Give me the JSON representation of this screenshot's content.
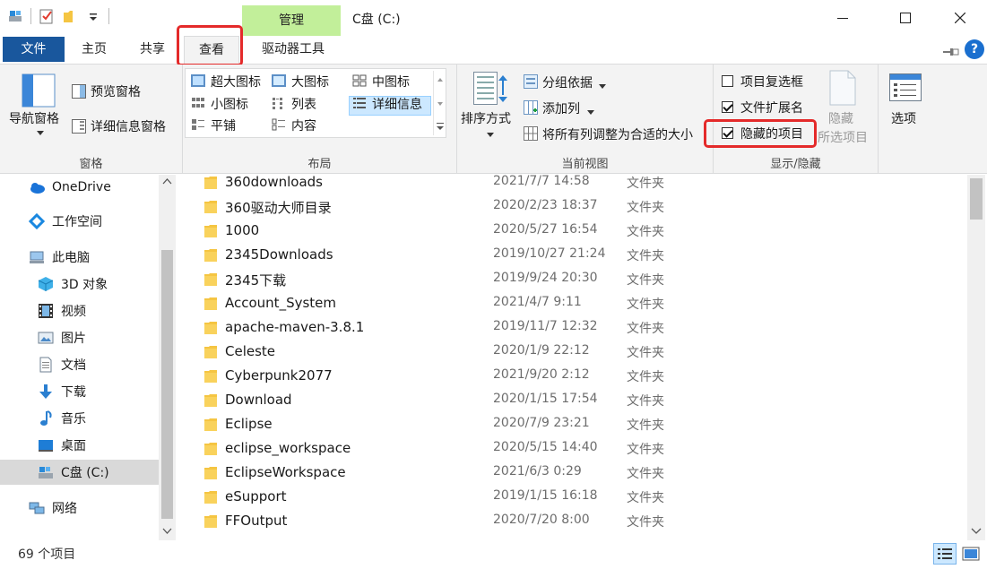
{
  "window": {
    "title": "C盘 (C:)",
    "contextual_tab": "管理"
  },
  "tabs": {
    "file": "文件",
    "home": "主页",
    "share": "共享",
    "view": "查看",
    "drive_tools": "驱动器工具"
  },
  "ribbon": {
    "panes": {
      "nav_pane": "导航窗格",
      "preview_pane": "预览窗格",
      "details_pane": "详细信息窗格",
      "label": "窗格"
    },
    "layout": {
      "extra_large": "超大图标",
      "large": "大图标",
      "medium": "中图标",
      "small": "小图标",
      "list": "列表",
      "details": "详细信息",
      "tiles": "平铺",
      "content": "内容",
      "label": "布局"
    },
    "current_view": {
      "sort_by": "排序方式",
      "group_by": "分组依据",
      "add_columns": "添加列",
      "size_all_columns": "将所有列调整为合适的大小",
      "label": "当前视图"
    },
    "show_hide": {
      "item_checkboxes": "项目复选框",
      "item_checkboxes_checked": false,
      "file_extensions": "文件扩展名",
      "file_extensions_checked": true,
      "hidden_items": "隐藏的项目",
      "hidden_items_checked": true,
      "hide_selected_line1": "隐藏",
      "hide_selected_line2": "所选项目",
      "label": "显示/隐藏"
    },
    "options": "选项"
  },
  "nav": {
    "items": [
      {
        "label": "OneDrive",
        "icon": "cloud-icon"
      },
      {
        "label": "工作空间",
        "icon": "workspace-icon"
      },
      {
        "label": "此电脑",
        "icon": "computer-icon"
      },
      {
        "label": "3D 对象",
        "icon": "cube-icon"
      },
      {
        "label": "视频",
        "icon": "film-icon"
      },
      {
        "label": "图片",
        "icon": "picture-icon"
      },
      {
        "label": "文档",
        "icon": "document-icon"
      },
      {
        "label": "下载",
        "icon": "download-arrow-icon"
      },
      {
        "label": "音乐",
        "icon": "music-note-icon"
      },
      {
        "label": "桌面",
        "icon": "desktop-icon"
      },
      {
        "label": "C盘 (C:)",
        "icon": "drive-icon"
      },
      {
        "label": "网络",
        "icon": "network-icon"
      }
    ]
  },
  "files": [
    {
      "name": "360downloads",
      "date": "2021/7/7 14:58",
      "type": "文件夹"
    },
    {
      "name": "360驱动大师目录",
      "date": "2020/2/23 18:37",
      "type": "文件夹"
    },
    {
      "name": "1000",
      "date": "2020/5/27 16:54",
      "type": "文件夹"
    },
    {
      "name": "2345Downloads",
      "date": "2019/10/27 21:24",
      "type": "文件夹"
    },
    {
      "name": "2345下载",
      "date": "2019/9/24 20:30",
      "type": "文件夹"
    },
    {
      "name": "Account_System",
      "date": "2021/4/7 9:11",
      "type": "文件夹"
    },
    {
      "name": "apache-maven-3.8.1",
      "date": "2019/11/7 12:32",
      "type": "文件夹"
    },
    {
      "name": "Celeste",
      "date": "2020/1/9 22:12",
      "type": "文件夹"
    },
    {
      "name": "Cyberpunk2077",
      "date": "2021/9/20 2:12",
      "type": "文件夹"
    },
    {
      "name": "Download",
      "date": "2020/1/15 17:54",
      "type": "文件夹"
    },
    {
      "name": "Eclipse",
      "date": "2020/7/9 23:21",
      "type": "文件夹"
    },
    {
      "name": "eclipse_workspace",
      "date": "2020/5/15 14:40",
      "type": "文件夹"
    },
    {
      "name": "EclipseWorkspace",
      "date": "2021/6/3 0:29",
      "type": "文件夹"
    },
    {
      "name": "eSupport",
      "date": "2019/1/15 16:18",
      "type": "文件夹"
    },
    {
      "name": "FFOutput",
      "date": "2020/7/20 8:00",
      "type": "文件夹"
    }
  ],
  "status": {
    "item_count": "69 个项目"
  },
  "colors": {
    "file_tab": "#19579d",
    "manage_tab": "#c2ef9a",
    "highlight": "#e42a2a",
    "folder": "#f5c542"
  }
}
